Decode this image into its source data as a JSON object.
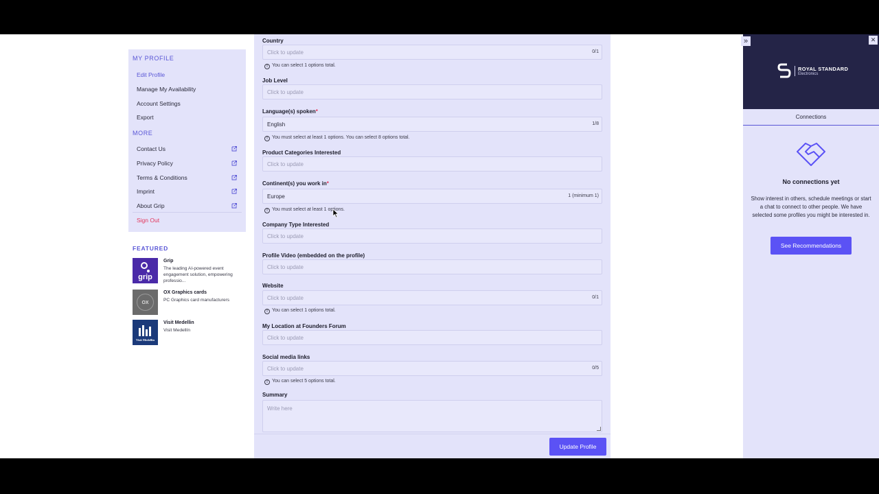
{
  "sidebar": {
    "my_profile_heading": "MY PROFILE",
    "items": [
      {
        "label": "Edit Profile"
      },
      {
        "label": "Manage My Availability"
      },
      {
        "label": "Account Settings"
      },
      {
        "label": "Export"
      }
    ],
    "more_heading": "MORE",
    "more_items": [
      {
        "label": "Contact Us"
      },
      {
        "label": "Privacy Policy"
      },
      {
        "label": "Terms & Conditions"
      },
      {
        "label": "Imprint"
      },
      {
        "label": "About Grip"
      }
    ],
    "signout": "Sign Out",
    "featured_heading": "FEATURED",
    "featured": [
      {
        "title": "Grip",
        "desc": "The leading AI-powered event engagement solution, empowering professio...",
        "thumb": "grip"
      },
      {
        "title": "OX Graphics cards",
        "desc": "PC Graphics card manufacturers",
        "thumb": "OX"
      },
      {
        "title": "Visit Medellin",
        "desc": "Visit Medellín",
        "thumb": "Visit Medellín"
      }
    ]
  },
  "form": {
    "country": {
      "label": "Country",
      "placeholder": "Click to update",
      "count": "0/1",
      "hint": "You can select 1 options total."
    },
    "job_level": {
      "label": "Job Level",
      "placeholder": "Click to update"
    },
    "languages": {
      "label": "Language(s) spoken",
      "required": "*",
      "value": "English",
      "count": "1/8",
      "hint": "You must select at least 1 options. You can select 8 options total."
    },
    "product_categories": {
      "label": "Product Categories Interested",
      "placeholder": "Click to update"
    },
    "continents": {
      "label": "Continent(s) you work in",
      "required": "*",
      "value": "Europe",
      "count": "1 (minimum 1)",
      "hint": "You must select at least 1 options."
    },
    "company_type": {
      "label": "Company Type Interested",
      "placeholder": "Click to update"
    },
    "profile_video": {
      "label": "Profile Video (embedded on the profile)",
      "placeholder": "Click to update"
    },
    "website": {
      "label": "Website",
      "placeholder": "Click to update",
      "count": "0/1",
      "hint": "You can select 1 options total."
    },
    "location": {
      "label": "My Location at Founders Forum",
      "placeholder": "Click to update"
    },
    "social": {
      "label": "Social media links",
      "placeholder": "Click to update",
      "count": "0/5",
      "hint": "You can select 5 options total."
    },
    "summary": {
      "label": "Summary",
      "placeholder": "Write here"
    },
    "submit": "Update Profile"
  },
  "right_panel": {
    "brand_name": "ROYAL STANDARD",
    "brand_sub": "Electronics",
    "tab": "Connections",
    "empty_title": "No connections yet",
    "empty_desc": "Show interest in others, schedule meetings or start a chat to connect to other people. We have selected some profiles you might be interested in.",
    "cta": "See Recommendations"
  },
  "colors": {
    "accent": "#5b52f5",
    "panel": "#e3e3fa",
    "danger": "#e3355b",
    "brand_bg": "#242447"
  }
}
